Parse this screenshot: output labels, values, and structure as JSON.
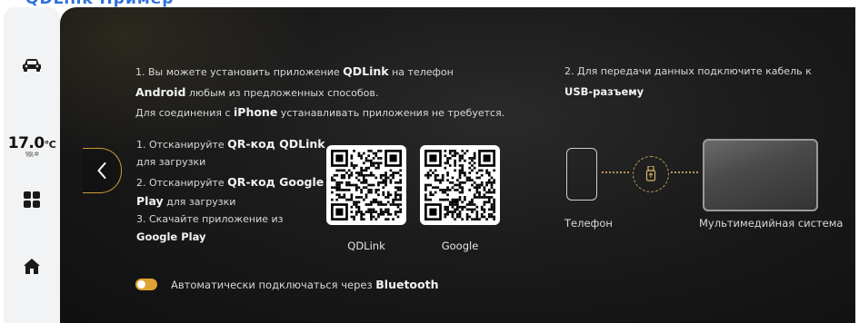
{
  "top_title": "QDLink Пример",
  "climate": {
    "temp": "17.0",
    "unit": "°C",
    "fan_bars": "\\\\\\\\\\\\ ✲"
  },
  "dock": {
    "icons": [
      "car-icon",
      "apps-grid-icon",
      "home-icon"
    ]
  },
  "instructions": {
    "line1_a": "1. Вы можете установить приложение ",
    "line1_b": "QDLink",
    "line1_c": " на телефон",
    "line2_a": "Android",
    "line2_b": " любым из предложенных способов.",
    "line3_a": "Для соединения с ",
    "line3_b": "iPhone",
    "line3_c": " устанавливать приложения не требуется."
  },
  "usb_instructions": {
    "line1": "2. Для передачи данных подключите кабель к",
    "line2": "USB-разъему"
  },
  "steps": {
    "s1_a": "1. Отсканируйте ",
    "s1_b": "QR-код QDLink",
    "s1_c": "для загрузки",
    "s2_a": "2. Отсканируйте ",
    "s2_b": "QR-код Google",
    "s2_c": "Play",
    "s2_d": " для загрузки",
    "s3_a": "3. Скачайте приложение из",
    "s3_b": "Google Play"
  },
  "qr_codes": [
    {
      "label": "QDLink"
    },
    {
      "label": "Google"
    }
  ],
  "diagram": {
    "phone_label": "Телефон",
    "system_label": "Мультимедийная система"
  },
  "auto_connect": {
    "label_a": "Автоматически подключаться через ",
    "label_b": "Bluetooth",
    "enabled": true
  },
  "colors": {
    "accent": "#e0a233",
    "panel_bg": "#1b1b1b",
    "dock_bg": "#f2f3f5",
    "title_blue": "#2f6fe0"
  }
}
